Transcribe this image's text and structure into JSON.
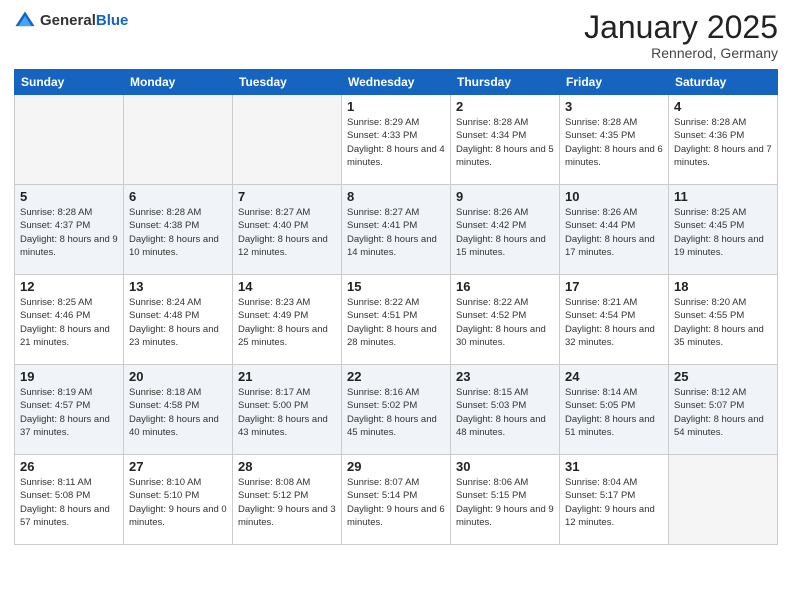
{
  "header": {
    "logo_general": "General",
    "logo_blue": "Blue",
    "month_title": "January 2025",
    "location": "Rennerod, Germany"
  },
  "weekdays": [
    "Sunday",
    "Monday",
    "Tuesday",
    "Wednesday",
    "Thursday",
    "Friday",
    "Saturday"
  ],
  "weeks": [
    [
      {
        "day": "",
        "sunrise": "",
        "sunset": "",
        "daylight": ""
      },
      {
        "day": "",
        "sunrise": "",
        "sunset": "",
        "daylight": ""
      },
      {
        "day": "",
        "sunrise": "",
        "sunset": "",
        "daylight": ""
      },
      {
        "day": "1",
        "sunrise": "Sunrise: 8:29 AM",
        "sunset": "Sunset: 4:33 PM",
        "daylight": "Daylight: 8 hours and 4 minutes."
      },
      {
        "day": "2",
        "sunrise": "Sunrise: 8:28 AM",
        "sunset": "Sunset: 4:34 PM",
        "daylight": "Daylight: 8 hours and 5 minutes."
      },
      {
        "day": "3",
        "sunrise": "Sunrise: 8:28 AM",
        "sunset": "Sunset: 4:35 PM",
        "daylight": "Daylight: 8 hours and 6 minutes."
      },
      {
        "day": "4",
        "sunrise": "Sunrise: 8:28 AM",
        "sunset": "Sunset: 4:36 PM",
        "daylight": "Daylight: 8 hours and 7 minutes."
      }
    ],
    [
      {
        "day": "5",
        "sunrise": "Sunrise: 8:28 AM",
        "sunset": "Sunset: 4:37 PM",
        "daylight": "Daylight: 8 hours and 9 minutes."
      },
      {
        "day": "6",
        "sunrise": "Sunrise: 8:28 AM",
        "sunset": "Sunset: 4:38 PM",
        "daylight": "Daylight: 8 hours and 10 minutes."
      },
      {
        "day": "7",
        "sunrise": "Sunrise: 8:27 AM",
        "sunset": "Sunset: 4:40 PM",
        "daylight": "Daylight: 8 hours and 12 minutes."
      },
      {
        "day": "8",
        "sunrise": "Sunrise: 8:27 AM",
        "sunset": "Sunset: 4:41 PM",
        "daylight": "Daylight: 8 hours and 14 minutes."
      },
      {
        "day": "9",
        "sunrise": "Sunrise: 8:26 AM",
        "sunset": "Sunset: 4:42 PM",
        "daylight": "Daylight: 8 hours and 15 minutes."
      },
      {
        "day": "10",
        "sunrise": "Sunrise: 8:26 AM",
        "sunset": "Sunset: 4:44 PM",
        "daylight": "Daylight: 8 hours and 17 minutes."
      },
      {
        "day": "11",
        "sunrise": "Sunrise: 8:25 AM",
        "sunset": "Sunset: 4:45 PM",
        "daylight": "Daylight: 8 hours and 19 minutes."
      }
    ],
    [
      {
        "day": "12",
        "sunrise": "Sunrise: 8:25 AM",
        "sunset": "Sunset: 4:46 PM",
        "daylight": "Daylight: 8 hours and 21 minutes."
      },
      {
        "day": "13",
        "sunrise": "Sunrise: 8:24 AM",
        "sunset": "Sunset: 4:48 PM",
        "daylight": "Daylight: 8 hours and 23 minutes."
      },
      {
        "day": "14",
        "sunrise": "Sunrise: 8:23 AM",
        "sunset": "Sunset: 4:49 PM",
        "daylight": "Daylight: 8 hours and 25 minutes."
      },
      {
        "day": "15",
        "sunrise": "Sunrise: 8:22 AM",
        "sunset": "Sunset: 4:51 PM",
        "daylight": "Daylight: 8 hours and 28 minutes."
      },
      {
        "day": "16",
        "sunrise": "Sunrise: 8:22 AM",
        "sunset": "Sunset: 4:52 PM",
        "daylight": "Daylight: 8 hours and 30 minutes."
      },
      {
        "day": "17",
        "sunrise": "Sunrise: 8:21 AM",
        "sunset": "Sunset: 4:54 PM",
        "daylight": "Daylight: 8 hours and 32 minutes."
      },
      {
        "day": "18",
        "sunrise": "Sunrise: 8:20 AM",
        "sunset": "Sunset: 4:55 PM",
        "daylight": "Daylight: 8 hours and 35 minutes."
      }
    ],
    [
      {
        "day": "19",
        "sunrise": "Sunrise: 8:19 AM",
        "sunset": "Sunset: 4:57 PM",
        "daylight": "Daylight: 8 hours and 37 minutes."
      },
      {
        "day": "20",
        "sunrise": "Sunrise: 8:18 AM",
        "sunset": "Sunset: 4:58 PM",
        "daylight": "Daylight: 8 hours and 40 minutes."
      },
      {
        "day": "21",
        "sunrise": "Sunrise: 8:17 AM",
        "sunset": "Sunset: 5:00 PM",
        "daylight": "Daylight: 8 hours and 43 minutes."
      },
      {
        "day": "22",
        "sunrise": "Sunrise: 8:16 AM",
        "sunset": "Sunset: 5:02 PM",
        "daylight": "Daylight: 8 hours and 45 minutes."
      },
      {
        "day": "23",
        "sunrise": "Sunrise: 8:15 AM",
        "sunset": "Sunset: 5:03 PM",
        "daylight": "Daylight: 8 hours and 48 minutes."
      },
      {
        "day": "24",
        "sunrise": "Sunrise: 8:14 AM",
        "sunset": "Sunset: 5:05 PM",
        "daylight": "Daylight: 8 hours and 51 minutes."
      },
      {
        "day": "25",
        "sunrise": "Sunrise: 8:12 AM",
        "sunset": "Sunset: 5:07 PM",
        "daylight": "Daylight: 8 hours and 54 minutes."
      }
    ],
    [
      {
        "day": "26",
        "sunrise": "Sunrise: 8:11 AM",
        "sunset": "Sunset: 5:08 PM",
        "daylight": "Daylight: 8 hours and 57 minutes."
      },
      {
        "day": "27",
        "sunrise": "Sunrise: 8:10 AM",
        "sunset": "Sunset: 5:10 PM",
        "daylight": "Daylight: 9 hours and 0 minutes."
      },
      {
        "day": "28",
        "sunrise": "Sunrise: 8:08 AM",
        "sunset": "Sunset: 5:12 PM",
        "daylight": "Daylight: 9 hours and 3 minutes."
      },
      {
        "day": "29",
        "sunrise": "Sunrise: 8:07 AM",
        "sunset": "Sunset: 5:14 PM",
        "daylight": "Daylight: 9 hours and 6 minutes."
      },
      {
        "day": "30",
        "sunrise": "Sunrise: 8:06 AM",
        "sunset": "Sunset: 5:15 PM",
        "daylight": "Daylight: 9 hours and 9 minutes."
      },
      {
        "day": "31",
        "sunrise": "Sunrise: 8:04 AM",
        "sunset": "Sunset: 5:17 PM",
        "daylight": "Daylight: 9 hours and 12 minutes."
      },
      {
        "day": "",
        "sunrise": "",
        "sunset": "",
        "daylight": ""
      }
    ]
  ]
}
